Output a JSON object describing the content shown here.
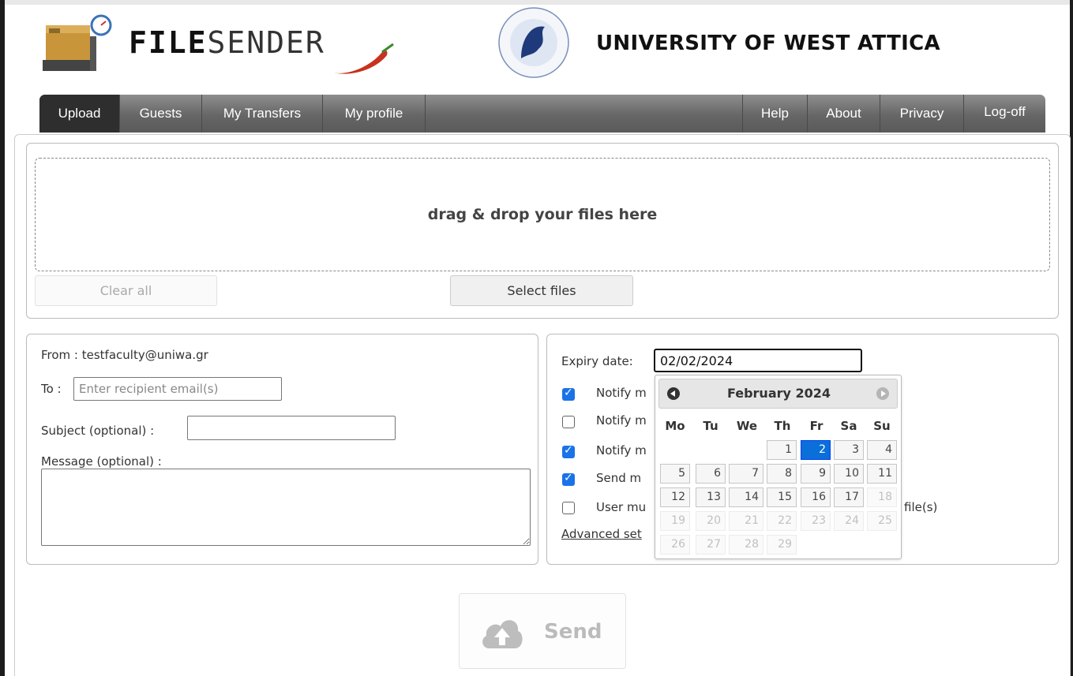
{
  "brand": {
    "logo_bold": "FILE",
    "logo_light": "SENDER",
    "university": "UNIVERSITY OF WEST ATTICA"
  },
  "nav": {
    "left": [
      "Upload",
      "Guests",
      "My Transfers",
      "My profile"
    ],
    "right": [
      "Help",
      "About",
      "Privacy",
      "Log-off"
    ],
    "active": "Upload"
  },
  "upload": {
    "dropzone_text": "drag & drop your files here",
    "clear_all": "Clear all",
    "select_files": "Select files"
  },
  "form": {
    "from_label": "From : testfaculty@uniwa.gr",
    "to_label": "To :",
    "to_placeholder": "Enter recipient email(s)",
    "subject_label": "Subject (optional) :",
    "subject_value": "",
    "message_label": "Message (optional) :",
    "message_value": ""
  },
  "options": {
    "expiry_label": "Expiry date:",
    "expiry_value": "02/02/2024",
    "items": [
      {
        "label": "Notify m",
        "checked": true
      },
      {
        "label": "Notify m",
        "checked": false
      },
      {
        "label": "Notify m",
        "checked": true
      },
      {
        "label": "Send m",
        "checked": true
      },
      {
        "label": "User mu",
        "checked": false
      }
    ],
    "user_mu_suffix": "file(s)",
    "advanced_link": "Advanced set"
  },
  "datepicker": {
    "title": "February 2024",
    "weekdays": [
      "Mo",
      "Tu",
      "We",
      "Th",
      "Fr",
      "Sa",
      "Su"
    ],
    "selected_day": "2",
    "days": [
      "1",
      "2",
      "3",
      "4",
      "5",
      "6",
      "7",
      "8",
      "9",
      "10",
      "11",
      "12",
      "13",
      "14",
      "15",
      "16",
      "17",
      "18",
      "19",
      "20",
      "21",
      "22",
      "23",
      "24",
      "25",
      "26",
      "27",
      "28",
      "29"
    ],
    "last_enabled_day": 17
  },
  "send": {
    "label": "Send"
  },
  "icons": [
    "scale-box-logo-icon",
    "chili-pepper-icon",
    "university-seal-icon",
    "prev-month-icon",
    "next-month-icon",
    "checkbox-icon",
    "cloud-upload-icon"
  ]
}
